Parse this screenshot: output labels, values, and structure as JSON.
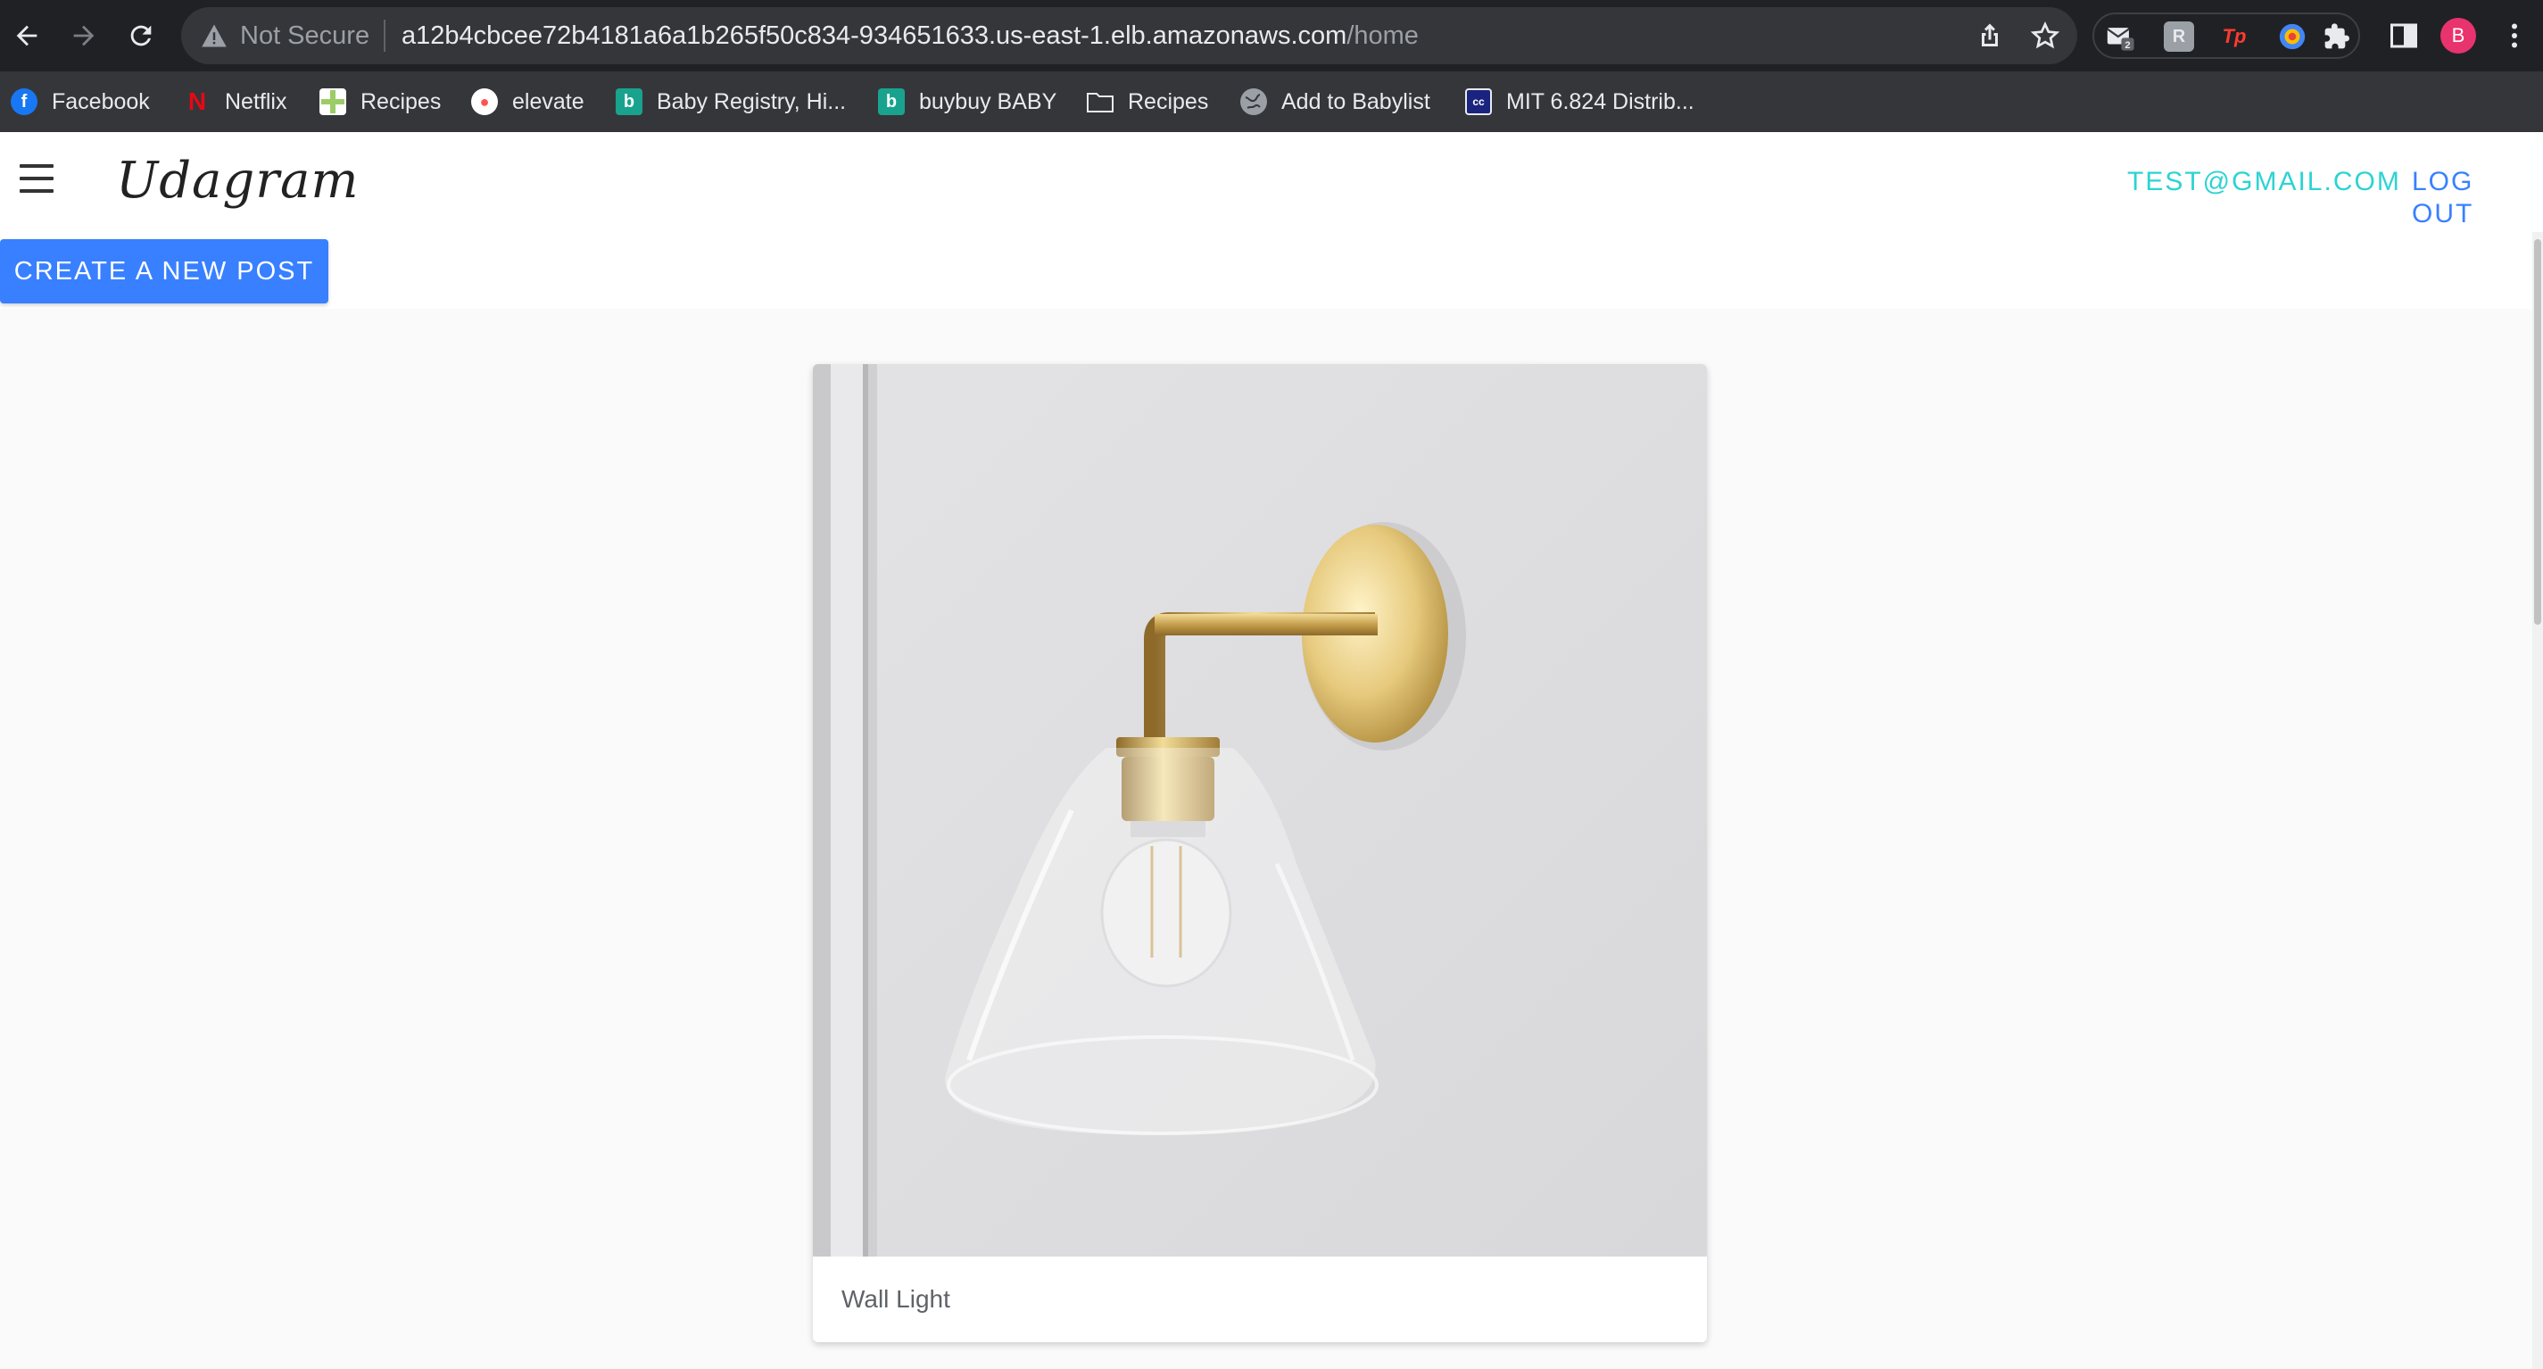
{
  "browser": {
    "security_label": "Not Secure",
    "url_host": "a12b4cbcee72b4181a6a1b265f50c834-934651633.us-east-1.elb.amazonaws.com",
    "url_path": "/home",
    "profile_initial": "B",
    "extensions": [
      {
        "name": "mail-extension-icon",
        "badge": "2"
      },
      {
        "name": "grammar-extension-icon",
        "label": "R"
      },
      {
        "name": "tp-extension-icon",
        "label": "Tp"
      },
      {
        "name": "color-extension-icon"
      }
    ],
    "bookmarks": [
      {
        "label": "Facebook",
        "icon": "facebook-icon",
        "color": "#1877f2"
      },
      {
        "label": "Netflix",
        "icon": "netflix-icon",
        "color": "#e50914"
      },
      {
        "label": "Recipes",
        "icon": "recipes-icon",
        "color": "#9ccc65"
      },
      {
        "label": "elevate",
        "icon": "elevate-icon",
        "color": "#ff5252"
      },
      {
        "label": "Baby Registry, Hi...",
        "icon": "babylist-icon",
        "color": "#19a38e"
      },
      {
        "label": "buybuy BABY",
        "icon": "buybuybaby-icon",
        "color": "#19a38e"
      },
      {
        "label": "Recipes",
        "icon": "folder-icon",
        "color": "#9aa0a6"
      },
      {
        "label": "Add to Babylist",
        "icon": "globe-icon",
        "color": "#9aa0a6"
      },
      {
        "label": "MIT 6.824 Distrib...",
        "icon": "cc-icon",
        "color": "#1a237e"
      }
    ]
  },
  "app": {
    "brand": "Udagram",
    "user_email": "TEST@GMAIL.COM",
    "logout_label": "LOG OUT",
    "create_post_label": "CREATE A NEW POST",
    "accent_color": "#3880ff",
    "email_color": "#2dd3d3"
  },
  "feed": {
    "posts": [
      {
        "caption": "Wall Light"
      }
    ]
  }
}
